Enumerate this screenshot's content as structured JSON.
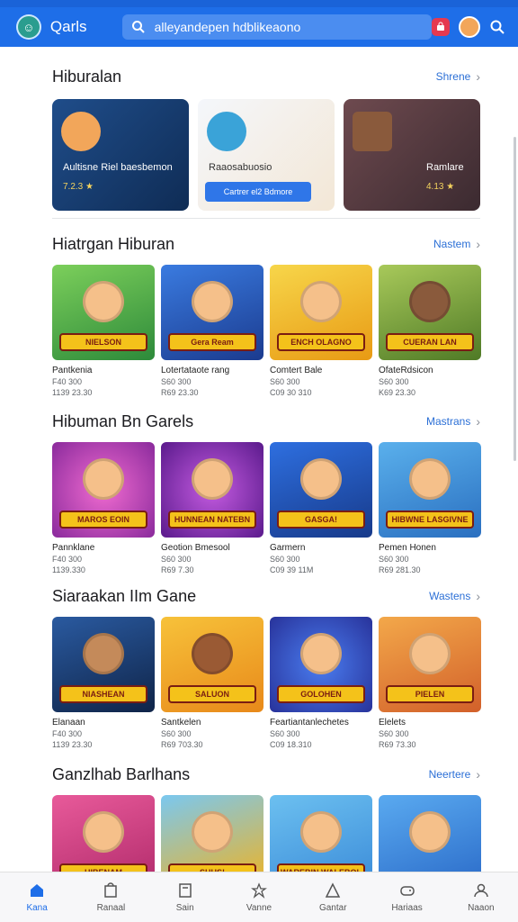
{
  "header": {
    "title": "Qarls",
    "search_text": "alleyandepen hdblikeaono"
  },
  "sections": [
    {
      "title": "Hiburalan",
      "link": "Shrene",
      "items": [
        {
          "title": "Aultisne Riel baesbemon",
          "rating": "7.2.3 ★",
          "color": "#1c3f74"
        },
        {
          "title": "Raaosabuosio",
          "button": "Cartrer el2 Bdmore",
          "color": "#eef3f9"
        },
        {
          "title": "Ramlare",
          "rating": "4.13 ★",
          "color": "#5a3d3f"
        }
      ]
    },
    {
      "title": "Hiatrgan Hiburan",
      "link": "Nastem",
      "items": [
        {
          "banner": "NIELSON",
          "name": "Pantkenia",
          "meta1": "F40 300",
          "meta2": "1139 23.30",
          "color": "#3f9e4a"
        },
        {
          "banner": "Gera Ream",
          "name": "Lotertataote rang",
          "meta1": "S60 300",
          "meta2": "R69 23.30",
          "color": "#2a5bb5"
        },
        {
          "banner": "ENCH OLAGNO",
          "name": "Comtert Bale",
          "meta1": "S60 300",
          "meta2": "C09 30 310",
          "color": "#f0b21e"
        },
        {
          "banner": "CUERAN LAN",
          "name": "OfateRdsicon",
          "meta1": "S60 300",
          "meta2": "K69 23.30",
          "color": "#6b8f2e"
        }
      ]
    },
    {
      "title": "Hibuman Bn Garels",
      "link": "Mastrans",
      "items": [
        {
          "banner": "MAROS EOIN",
          "name": "Pannklane",
          "meta1": "F40 300",
          "meta2": "1139.330",
          "color": "#c048a8"
        },
        {
          "banner": "HUNNEAN NATEBN",
          "name": "Geotion Bmesool",
          "meta1": "S60 300",
          "meta2": "R69 7.30",
          "color": "#8a2fb0"
        },
        {
          "banner": "GASGA!",
          "name": "Garmern",
          "meta1": "S60 300",
          "meta2": "C09 39 11M",
          "color": "#1e59c4"
        },
        {
          "banner": "HIBWNE LASGIVNE",
          "name": "Pemen Honen",
          "meta1": "S60 300",
          "meta2": "R69 281.30",
          "color": "#2e8bd6"
        }
      ]
    },
    {
      "title": "Siaraakan IIm Gane",
      "link": "Wastens",
      "items": [
        {
          "banner": "NIASHEAN",
          "name": "Elanaan",
          "meta1": "F40 300",
          "meta2": "1139 23.30",
          "color": "#1b3b6b"
        },
        {
          "banner": "SALUON",
          "name": "Santkelen",
          "meta1": "S60 300",
          "meta2": "R69 703.30",
          "color": "#f2a51c"
        },
        {
          "banner": "GOLOHEN",
          "name": "Feartiantanlechetes",
          "meta1": "S60 300",
          "meta2": "C09 18.310",
          "color": "#3557c9"
        },
        {
          "banner": "PIELEN",
          "name": "Elelets",
          "meta1": "S60 300",
          "meta2": "R69 73.30",
          "color": "#e0823a"
        }
      ]
    },
    {
      "title": "Ganzlhab Barlhans",
      "link": "Neertere",
      "items": [
        {
          "banner": "HIBENAM",
          "color": "#d63a7a"
        },
        {
          "banner": "SHUS!",
          "color": "#f1b21c"
        },
        {
          "banner": "WAREBIN WALEBOL",
          "color": "#5ab0e8"
        },
        {
          "banner": "",
          "color": "#3e8fd8"
        }
      ]
    }
  ],
  "bottom_nav": [
    {
      "label": "Kana",
      "icon": "home-icon",
      "active": true
    },
    {
      "label": "Ranaal",
      "icon": "store-icon"
    },
    {
      "label": "Sain",
      "icon": "book-icon"
    },
    {
      "label": "Vanne",
      "icon": "star-icon"
    },
    {
      "label": "Gantar",
      "icon": "tent-icon"
    },
    {
      "label": "Hariaas",
      "icon": "gamepad-icon"
    },
    {
      "label": "Naaon",
      "icon": "profile-icon"
    }
  ]
}
